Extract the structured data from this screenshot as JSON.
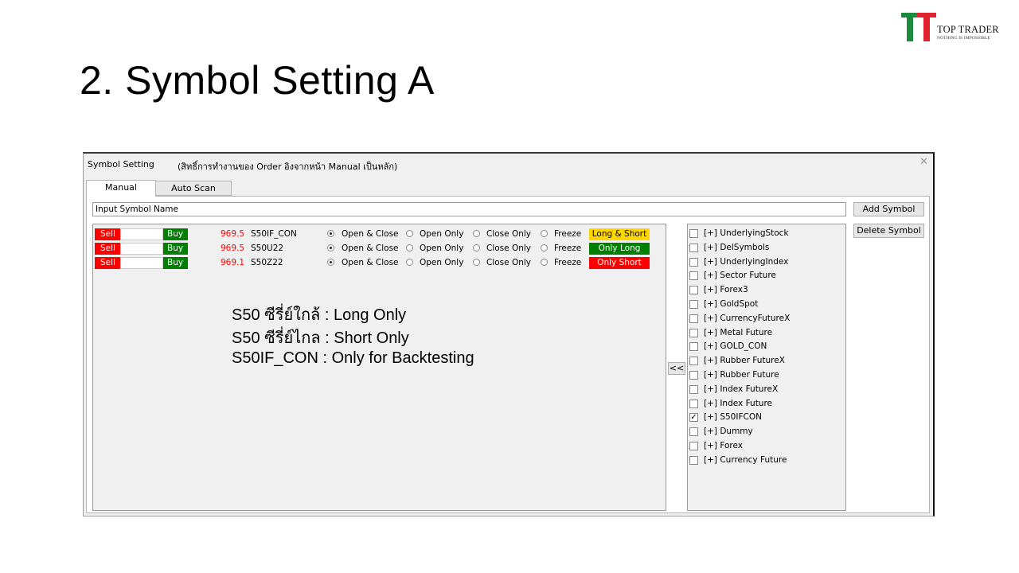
{
  "slide": {
    "title": "2. Symbol Setting A"
  },
  "logo": {
    "brand": "TOP TRADER",
    "tagline": "NOTHING IS IMPOSSIBLE",
    "colors": {
      "green": "#1a8a3e",
      "red": "#e0232c"
    }
  },
  "window": {
    "title": "Symbol Setting",
    "note": "(สิทธิ์การทำงานของ Order อิงจากหน้า Manual เป็นหลัก)",
    "close_icon": "✕",
    "tabs": [
      {
        "label": "Manual",
        "active": true
      },
      {
        "label": "Auto Scan",
        "active": false
      }
    ],
    "input": {
      "value": "Input Symbol Name"
    },
    "buttons": {
      "add": "Add Symbol",
      "delete": "Delete Symbol",
      "move": "<<"
    }
  },
  "symbols": [
    {
      "sell": "Sell",
      "buy": "Buy",
      "price": "969.5",
      "name": "S50IF_CON",
      "options": [
        "Open & Close",
        "Open Only",
        "Close Only",
        "Freeze"
      ],
      "selected": 0,
      "mode": "Long & Short",
      "mode_bg": "#ffd700",
      "mode_fg": "#000000"
    },
    {
      "sell": "Sell",
      "buy": "Buy",
      "price": "969.5",
      "name": "S50U22",
      "options": [
        "Open & Close",
        "Open Only",
        "Close Only",
        "Freeze"
      ],
      "selected": 0,
      "mode": "Only Long",
      "mode_bg": "#008000",
      "mode_fg": "#ffffff"
    },
    {
      "sell": "Sell",
      "buy": "Buy",
      "price": "969.1",
      "name": "S50Z22",
      "options": [
        "Open & Close",
        "Open Only",
        "Close Only",
        "Freeze"
      ],
      "selected": 0,
      "mode": "Only Short",
      "mode_bg": "#ff0000",
      "mode_fg": "#ffffff"
    }
  ],
  "notes": [
    "S50 ซีรี่ย์ใกล้ : Long Only",
    "S50 ซีรี่ย์ไกล : Short Only",
    "S50IF_CON : Only for Backtesting"
  ],
  "symbol_groups": [
    {
      "label": "[+] UnderlyingStock",
      "checked": false
    },
    {
      "label": "[+] DelSymbols",
      "checked": false
    },
    {
      "label": "[+] UnderlyingIndex",
      "checked": false
    },
    {
      "label": "[+] Sector Future",
      "checked": false
    },
    {
      "label": "[+] Forex3",
      "checked": false
    },
    {
      "label": "[+] GoldSpot",
      "checked": false
    },
    {
      "label": "[+] CurrencyFutureX",
      "checked": false
    },
    {
      "label": "[+] Metal Future",
      "checked": false
    },
    {
      "label": "[+] GOLD_CON",
      "checked": false
    },
    {
      "label": "[+] Rubber FutureX",
      "checked": false
    },
    {
      "label": "[+] Rubber Future",
      "checked": false
    },
    {
      "label": "[+] Index FutureX",
      "checked": false
    },
    {
      "label": "[+] Index Future",
      "checked": false
    },
    {
      "label": "[+] S50IFCON",
      "checked": true
    },
    {
      "label": "[+] Dummy",
      "checked": false
    },
    {
      "label": "[+] Forex",
      "checked": false
    },
    {
      "label": "[+] Currency Future",
      "checked": false
    }
  ]
}
